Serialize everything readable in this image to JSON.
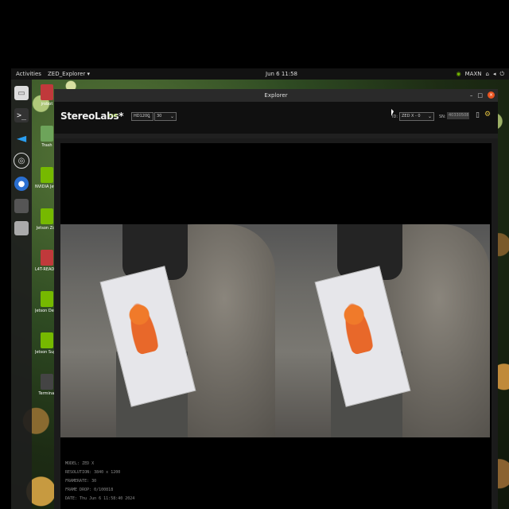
{
  "topbar": {
    "activities": "Activities",
    "app_menu": "ZED_Explorer ▾",
    "clock": "Jun 6  11:58",
    "power_mode": "MAXN"
  },
  "desktop_icons": [
    {
      "label": "jrobot",
      "icon": "folder-icon"
    },
    {
      "label": "Trash",
      "icon": "trash-icon"
    },
    {
      "label": "NVIDIA Jetson Community",
      "icon": "nvidia-icon"
    },
    {
      "label": "Jetson Zoo",
      "icon": "nvidia-icon"
    },
    {
      "label": "L4T-README",
      "icon": "folder-icon"
    },
    {
      "label": "Jetson Developer Z",
      "icon": "nvidia-icon"
    },
    {
      "label": "Jetson Support Forums",
      "icon": "nvidia-icon"
    },
    {
      "label": "Terminal",
      "icon": "terminal-icon"
    }
  ],
  "window": {
    "title": "Explorer"
  },
  "toolbar": {
    "brand": "StereoLabs*",
    "live": "LIVE",
    "resolution": "HD1200",
    "fps": "30",
    "id_label": "ID:",
    "id_value": "ZED X - 0",
    "sn_label": "SN:",
    "sn_value": "40330508"
  },
  "camera_info": {
    "model": "MODEL: ZED X",
    "resolution": "RESOLUTION: 3840 x 1200",
    "framerate": "FRAMERATE: 30",
    "frame_drop": "FRAME DROP: 0/100818",
    "date": "DATE: Thu Jun 6 11:58:40 2024"
  }
}
